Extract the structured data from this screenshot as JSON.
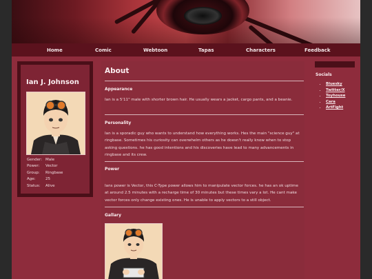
{
  "nav": {
    "items": [
      "Home",
      "Comic",
      "Webtoon",
      "Tapas",
      "Characters",
      "Feedback"
    ]
  },
  "profile": {
    "name": "Ian J. Johnson",
    "stats": [
      {
        "key": "Gender:",
        "value": "Male"
      },
      {
        "key": "Power:",
        "value": "Vector"
      },
      {
        "key": "Group:",
        "value": "Ringbase"
      },
      {
        "key": "Age:",
        "value": "25"
      },
      {
        "key": "Status:",
        "value": "Alive"
      }
    ]
  },
  "main": {
    "title": "About",
    "sections": [
      {
        "title": "Appearance",
        "body": "Ian is a 5'11\" male with shorter brown hair. He usually wears a jacket, cargo pants, and a beanie."
      },
      {
        "title": "Personality",
        "body": "Ian is a sporadic guy who wants to understand how everything works. Hes the main \"science guy\" at ringbase. Sometimes his curiosity can overwhelm others as he doesn't really know when to stop asking questions. he has good intentions and his discoveries have lead to many advancements in ringbase and its crew."
      },
      {
        "title": "Power",
        "body": "Ians power is Vector, this C-Type power allows him to manipulate vector forces. he has an ok uptime at around 2.5 minutes with a recharge time of 30 minutes but these times vary a lot. He cant make vector forces only change existing ones. He is unable to apply vectors to a still object."
      },
      {
        "title": "Gallary",
        "body": ""
      }
    ]
  },
  "socials": {
    "title": "Socials",
    "links": [
      "Bluesky",
      "Twitter/X",
      "Toyhouse",
      "Cara",
      "ArtFight"
    ]
  },
  "colors": {
    "page_bg": "#8e2c3c",
    "nav_bg": "#5b121d",
    "panel_dark": "#4a0f18",
    "outer_bg": "#2a2a2a"
  }
}
